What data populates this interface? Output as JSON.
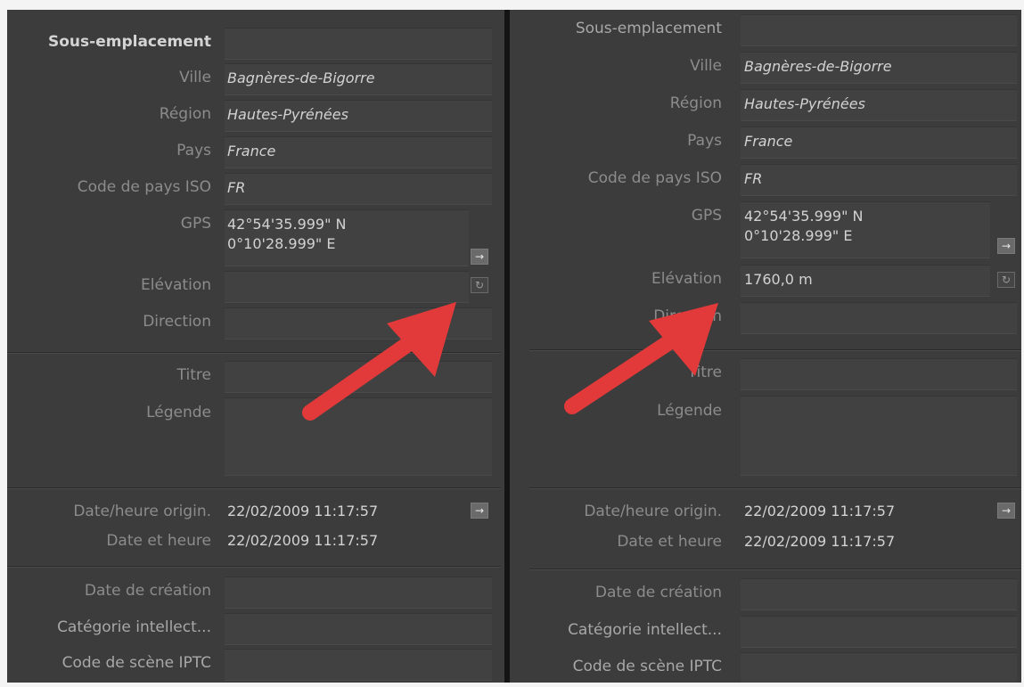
{
  "left": {
    "sublocation_label": "Sous-emplacement",
    "city_label": "Ville",
    "city_value": "Bagnères-de-Bigorre",
    "region_label": "Région",
    "region_value": "Hautes-Pyrénées",
    "country_label": "Pays",
    "country_value": "France",
    "iso_label": "Code de pays ISO",
    "iso_value": "FR",
    "gps_label": "GPS",
    "gps_lat": "42°54'35.999\" N",
    "gps_lon": "0°10'28.999\" E",
    "elevation_label": "Elévation",
    "direction_label": "Direction",
    "title_label": "Titre",
    "caption_label": "Légende",
    "date_orig_label": "Date/heure origin.",
    "date_orig_value": "22/02/2009 11:17:57",
    "date_label": "Date et heure",
    "date_value": "22/02/2009 11:17:57",
    "creation_label": "Date de création",
    "genre_label": "Catégorie intellect...",
    "scene_label": "Code de scène IPTC"
  },
  "right": {
    "sublocation_label": "Sous-emplacement",
    "city_label": "Ville",
    "city_value": "Bagnères-de-Bigorre",
    "region_label": "Région",
    "region_value": "Hautes-Pyrénées",
    "country_label": "Pays",
    "country_value": "France",
    "iso_label": "Code de pays ISO",
    "iso_value": "FR",
    "gps_label": "GPS",
    "gps_lat": "42°54'35.999\" N",
    "gps_lon": "0°10'28.999\" E",
    "elevation_label": "Elévation",
    "elevation_value": "1760,0 m",
    "direction_label": "Direction",
    "title_label": "Titre",
    "caption_label": "Légende",
    "date_orig_label": "Date/heure origin.",
    "date_orig_value": "22/02/2009 11:17:57",
    "date_label": "Date et heure",
    "date_value": "22/02/2009 11:17:57",
    "creation_label": "Date de création",
    "genre_label": "Catégorie intellect...",
    "scene_label": "Code de scène IPTC"
  },
  "icons": {
    "goto": "arrow-right-icon",
    "refresh": "refresh-icon",
    "annotation": "red-arrow-icon"
  },
  "colors": {
    "panel_bg": "#3c3c3c",
    "annotation_arrow": "#e23a3a"
  }
}
